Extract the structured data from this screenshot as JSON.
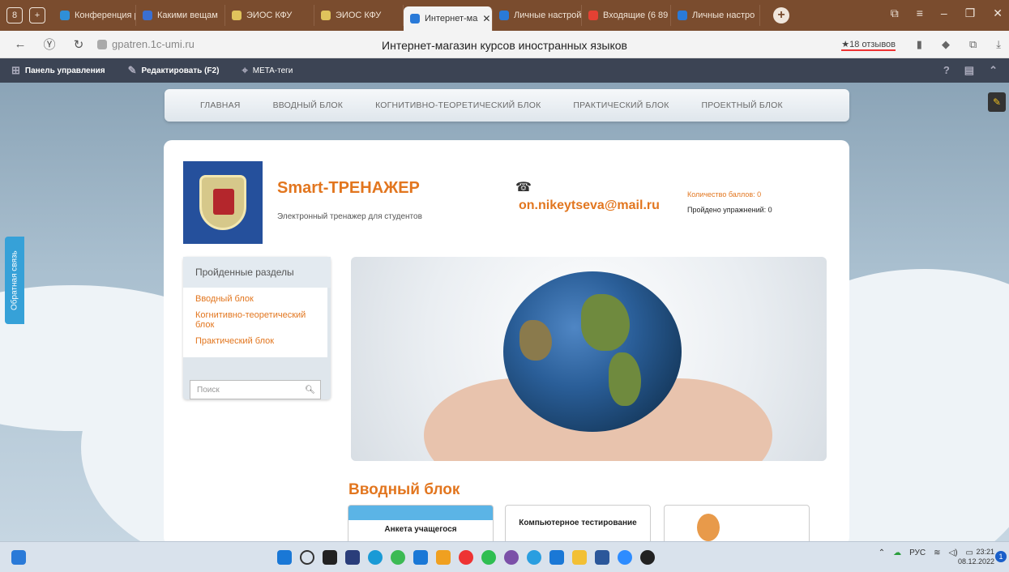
{
  "browser": {
    "tabs": [
      {
        "label": "Конференция р",
        "color": "#2f8fd8"
      },
      {
        "label": "Какими вещам",
        "color": "#3a6fd1"
      },
      {
        "label": "ЭИОС КФУ",
        "color": "#e0c35c"
      },
      {
        "label": "ЭИОС КФУ",
        "color": "#e0c35c"
      },
      {
        "label": "Интернет-ма",
        "color": "#2a7ad8",
        "active": true
      },
      {
        "label": "Личные настрой",
        "color": "#2a7ad8"
      },
      {
        "label": "Входящие (6 89",
        "color": "#e44133"
      },
      {
        "label": "Личные настро",
        "color": "#2a7ad8"
      }
    ],
    "tab_counter": "8",
    "url": "gpatren.1c-umi.ru",
    "page_title": "Интернет-магазин курсов иностранных языков",
    "reviews": "★18 отзывов"
  },
  "admin": {
    "panel": "Панель управления",
    "edit": "Редактировать (F2)",
    "meta": "META-теги"
  },
  "menu": [
    "ГЛАВНАЯ",
    "ВВОДНЫЙ БЛОК",
    "КОГНИТИВНО-ТЕОРЕТИЧЕСКИЙ БЛОК",
    "ПРАКТИЧЕСКИЙ БЛОК",
    "ПРОЕКТНЫЙ БЛОК"
  ],
  "feedback": "Обратная связь",
  "header": {
    "brand": "Smart-ТРЕНАЖЕР",
    "subtitle": "Электронный тренажер для студентов",
    "email": "on.nikeytseva@mail.ru",
    "score": "Количество баллов: 0",
    "exercises": "Пройдено упражнений: 0"
  },
  "sidebar": {
    "title": "Пройденные разделы",
    "items": [
      "Вводный блок",
      "Когнитивно-теоретический блок",
      "Практический блок"
    ],
    "search_placeholder": "Поиск"
  },
  "section": {
    "title": "Вводный блок",
    "cards": [
      "Анкета учащегося",
      "Компьютерное тестирование",
      ""
    ]
  },
  "taskbar": {
    "lang": "РУС",
    "time": "23:21",
    "date": "08.12.2022",
    "notifications": "1"
  }
}
